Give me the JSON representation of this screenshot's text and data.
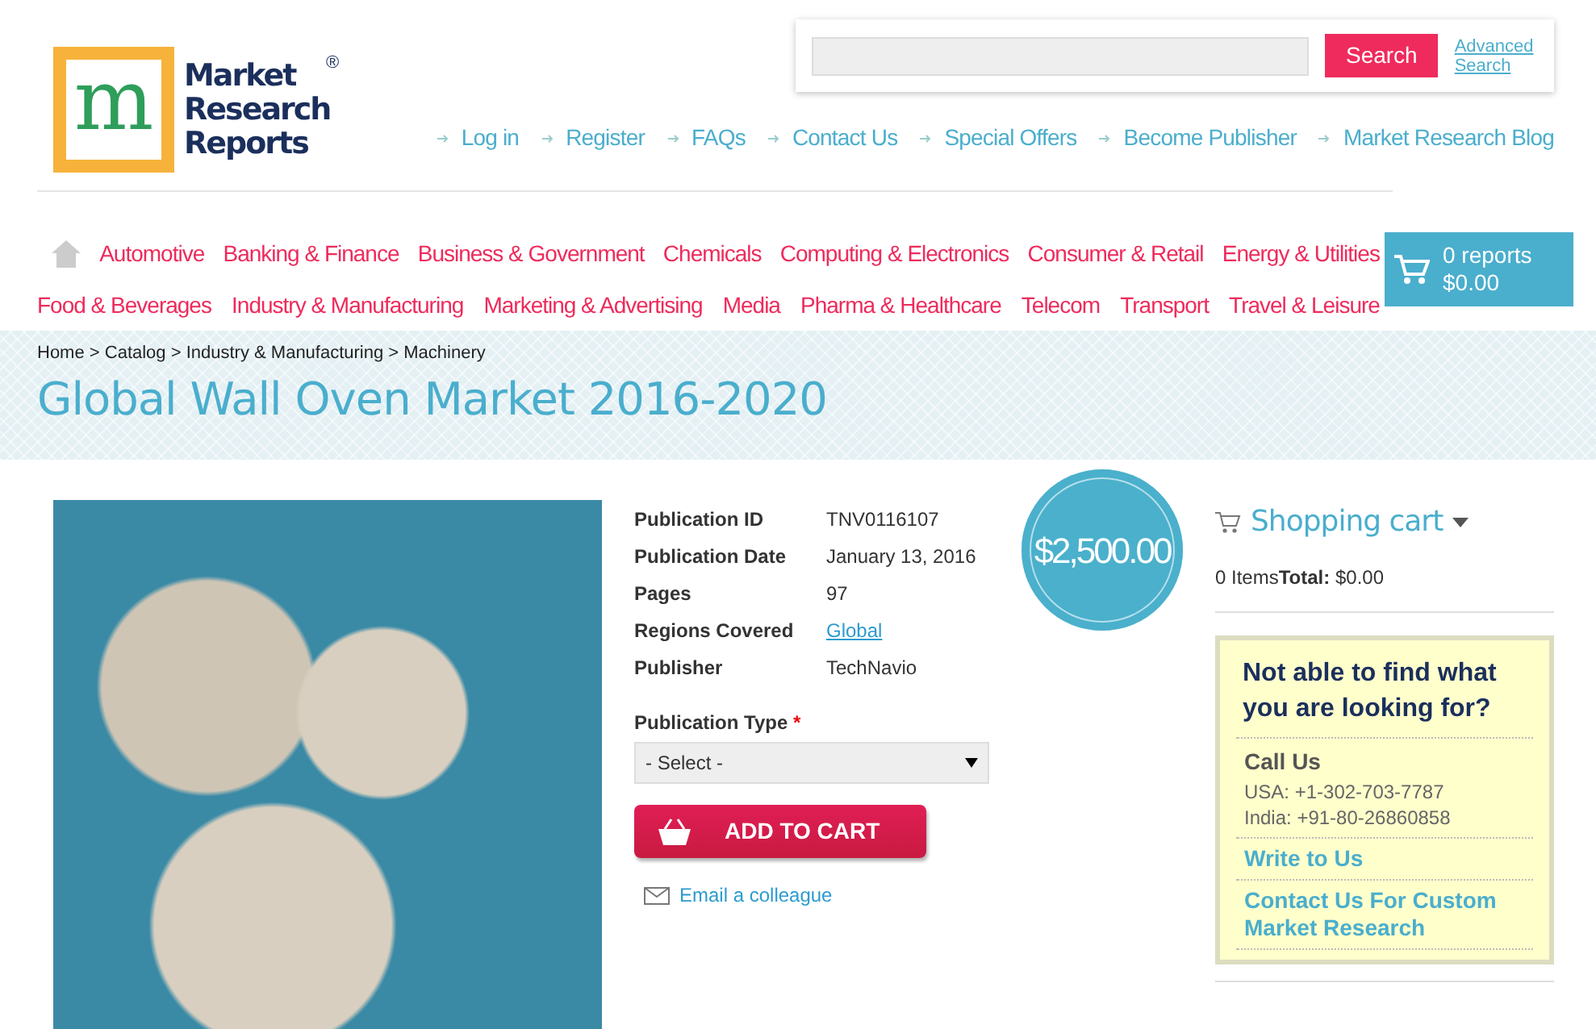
{
  "logo": {
    "mark": "m",
    "text": "Market Research Reports",
    "registered": "®"
  },
  "search": {
    "button": "Search",
    "advanced": "Advanced Search"
  },
  "top_links": [
    "Log in",
    "Register",
    "FAQs",
    "Contact Us",
    "Special Offers",
    "Become Publisher",
    "Market Research Blog"
  ],
  "category_rows": [
    [
      "Automotive",
      "Banking & Finance",
      "Business & Government",
      "Chemicals",
      "Computing & Electronics",
      "Consumer & Retail",
      "Energy & Utilities"
    ],
    [
      "Food & Beverages",
      "Industry & Manufacturing",
      "Marketing & Advertising",
      "Media",
      "Pharma & Healthcare",
      "Telecom",
      "Transport",
      "Travel & Leisure"
    ]
  ],
  "cart_box": {
    "count": "0 reports",
    "total": "$0.00"
  },
  "breadcrumb": {
    "separator": ">",
    "items": [
      "Home",
      "Catalog",
      "Industry & Manufacturing",
      "Machinery"
    ]
  },
  "title": "Global Wall Oven Market 2016-2020",
  "details": [
    {
      "label": "Publication ID",
      "value": "TNV0116107",
      "kind": "text"
    },
    {
      "label": "Publication Date",
      "value": "January 13, 2016",
      "kind": "text"
    },
    {
      "label": "Pages",
      "value": "97",
      "kind": "text"
    },
    {
      "label": "Regions Covered",
      "value": "Global",
      "kind": "link"
    },
    {
      "label": "Publisher",
      "value": "TechNavio",
      "kind": "text"
    }
  ],
  "publication_type": {
    "label": "Publication Type",
    "required_mark": "*",
    "select": "- Select -"
  },
  "add_to_cart": "ADD TO CART",
  "email_link": "Email a colleague",
  "price": "$2,500.00",
  "sidebar": {
    "cart_title": "Shopping cart",
    "cart_summary": "0 Items**Total:** $0.00",
    "help": {
      "heading": "Not able to find what you are looking for?",
      "call_title": "Call Us",
      "phones": [
        "USA: +1-302-703-7787",
        "India: +91-80-26860858"
      ],
      "links": [
        "Write to Us",
        "Contact Us For Custom Market Research"
      ]
    }
  }
}
